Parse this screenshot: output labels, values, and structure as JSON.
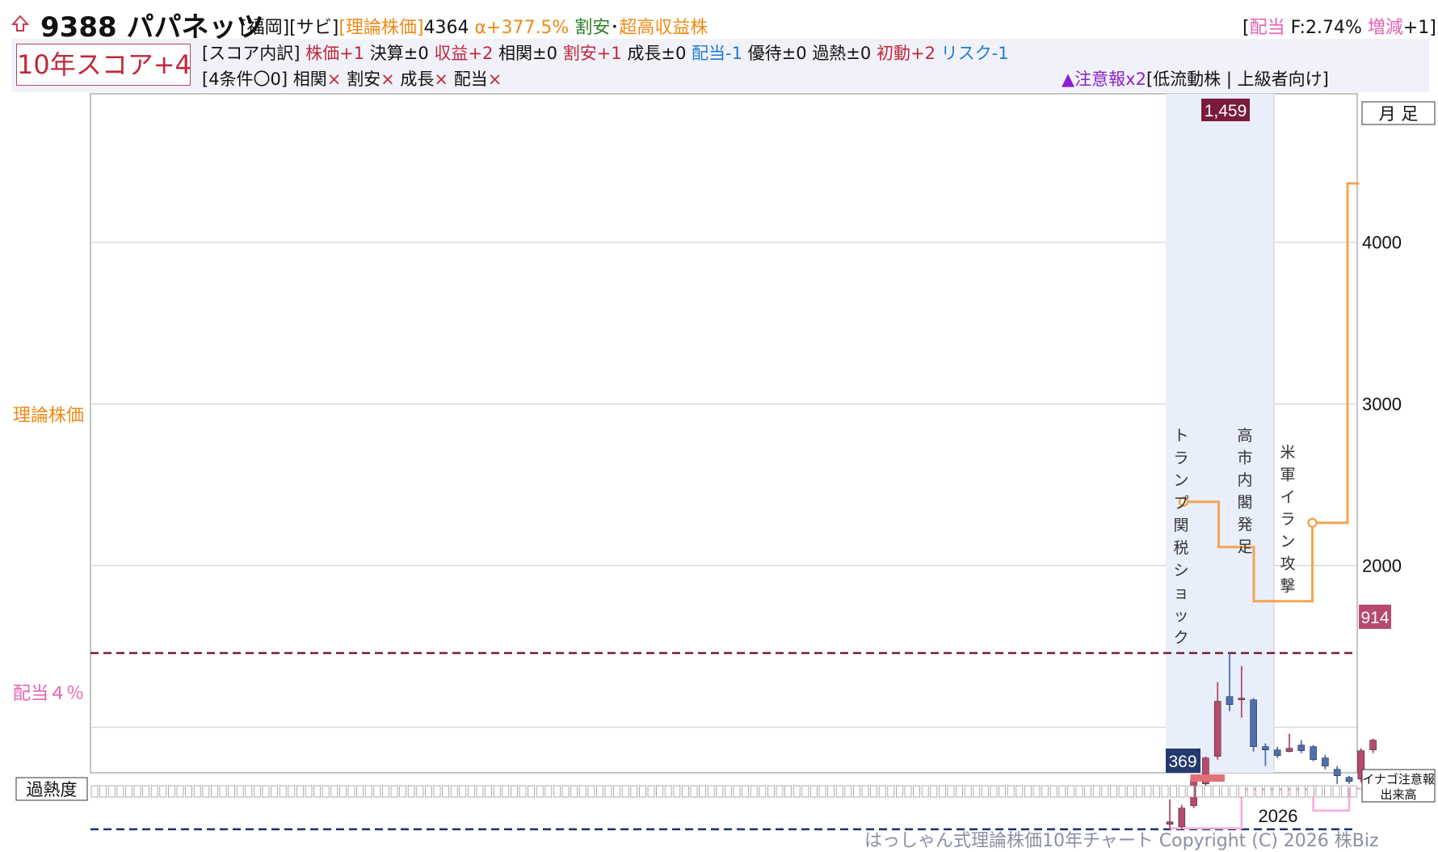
{
  "header": {
    "code_name": "9388 パパネッツ",
    "market": "[福岡][サビ]",
    "theory_label": "[理論株価]",
    "theory_value": "4364",
    "alpha": "α+377.5%",
    "tag_cheap": "割安",
    "tag_dot": "･",
    "tag_high_profit": "超高収益株",
    "dividend_open": "[",
    "dividend_label": "配当",
    "dividend_value": " F:2.74% ",
    "dividend_change_label": "増減",
    "dividend_change_value": "+1]"
  },
  "score": {
    "box_label": "10年スコア+4",
    "breakdown_prefix": "[スコア内訳]",
    "items": [
      {
        "label": "株価+1",
        "color": "red"
      },
      {
        "label": "決算±0",
        "color": "black"
      },
      {
        "label": "収益+2",
        "color": "red"
      },
      {
        "label": "相関±0",
        "color": "black"
      },
      {
        "label": "割安+1",
        "color": "red"
      },
      {
        "label": "成長±0",
        "color": "black"
      },
      {
        "label": "配当-1",
        "color": "blue"
      },
      {
        "label": "優待±0",
        "color": "black"
      },
      {
        "label": "過熱±0",
        "color": "black"
      },
      {
        "label": "初動+2",
        "color": "red"
      },
      {
        "label": "リスク-1",
        "color": "blue"
      }
    ],
    "conditions_prefix": "[4条件〇0]",
    "conditions": [
      {
        "label": "相関",
        "mark": "×"
      },
      {
        "label": "割安",
        "mark": "×"
      },
      {
        "label": "成長",
        "mark": "×"
      },
      {
        "label": "配当",
        "mark": "×"
      }
    ],
    "warning": "▲注意報x2",
    "warning_tags": "[低流動株 | 上級者向け]"
  },
  "side_labels": {
    "theory": "理論株価",
    "dividend": "配当４％",
    "overheat": "過熱度",
    "period": "月 足",
    "inago_1": "イナゴ注意報",
    "inago_2": "出来高"
  },
  "copyright": "はっしゃん式理論株価10年チャート Copyright (C) 2026 株Biz",
  "colors": {
    "up": "#b84a6e",
    "down": "#4f70b0",
    "theory": "#f5a452",
    "dividend_line": "#f7a9dc",
    "high_line": "#7a1b3c",
    "low_line": "#1f2f6e",
    "highlight": "#e8effb"
  },
  "chart_data": {
    "type": "candlestick",
    "period": "monthly",
    "ylim": [
      0,
      4350
    ],
    "yticks": [
      4000,
      3000,
      2000
    ],
    "x_tick_label": "2026",
    "high_marker": {
      "label": "1,459",
      "value": 1459
    },
    "low_marker": {
      "label": "369",
      "value": 369
    },
    "last_marker": {
      "label": "914",
      "value": 914
    },
    "events": [
      {
        "label": "トランプ関税ショック",
        "month_index": 0
      },
      {
        "label": "高市内閣発足",
        "month_index": 6
      },
      {
        "label": "米軍イラン攻撃",
        "month_index": 10
      }
    ],
    "candles": [
      {
        "o": 400,
        "h": 555,
        "l": 365,
        "c": 415
      },
      {
        "o": 385,
        "h": 520,
        "l": 369,
        "c": 500
      },
      {
        "o": 515,
        "h": 690,
        "l": 500,
        "c": 680
      },
      {
        "o": 650,
        "h": 820,
        "l": 630,
        "c": 810
      },
      {
        "o": 820,
        "h": 1280,
        "l": 800,
        "c": 1160
      },
      {
        "o": 1190,
        "h": 1459,
        "l": 1100,
        "c": 1140
      },
      {
        "o": 1170,
        "h": 1380,
        "l": 1060,
        "c": 1180
      },
      {
        "o": 1170,
        "h": 1180,
        "l": 850,
        "c": 880
      },
      {
        "o": 880,
        "h": 900,
        "l": 760,
        "c": 860
      },
      {
        "o": 860,
        "h": 880,
        "l": 810,
        "c": 825
      },
      {
        "o": 850,
        "h": 960,
        "l": 845,
        "c": 870
      },
      {
        "o": 890,
        "h": 920,
        "l": 840,
        "c": 855
      },
      {
        "o": 880,
        "h": 890,
        "l": 790,
        "c": 800
      },
      {
        "o": 810,
        "h": 830,
        "l": 740,
        "c": 760
      },
      {
        "o": 740,
        "h": 760,
        "l": 650,
        "c": 700
      },
      {
        "o": 690,
        "h": 700,
        "l": 650,
        "c": 665
      },
      {
        "o": 680,
        "h": 870,
        "l": 660,
        "c": 855
      },
      {
        "o": 860,
        "h": 930,
        "l": 840,
        "c": 920
      }
    ],
    "theory_line": [
      2395,
      2395,
      2395,
      2115,
      2115,
      2115,
      1780,
      1780,
      1780,
      1780,
      1780,
      2265,
      2265,
      2265,
      4364,
      4364
    ],
    "theory_line_x": [
      0,
      1,
      2,
      3,
      4,
      5,
      6,
      7,
      8,
      9,
      10,
      11,
      12,
      13,
      14,
      15
    ],
    "theory_markers": [
      0,
      11
    ],
    "dividend_line": [
      375,
      375,
      375,
      375,
      375,
      375,
      615,
      615,
      615,
      615,
      615,
      615,
      485,
      485,
      485,
      620,
      620
    ],
    "overheat_bar": {
      "start": 2,
      "end": 5,
      "level": 1
    }
  }
}
